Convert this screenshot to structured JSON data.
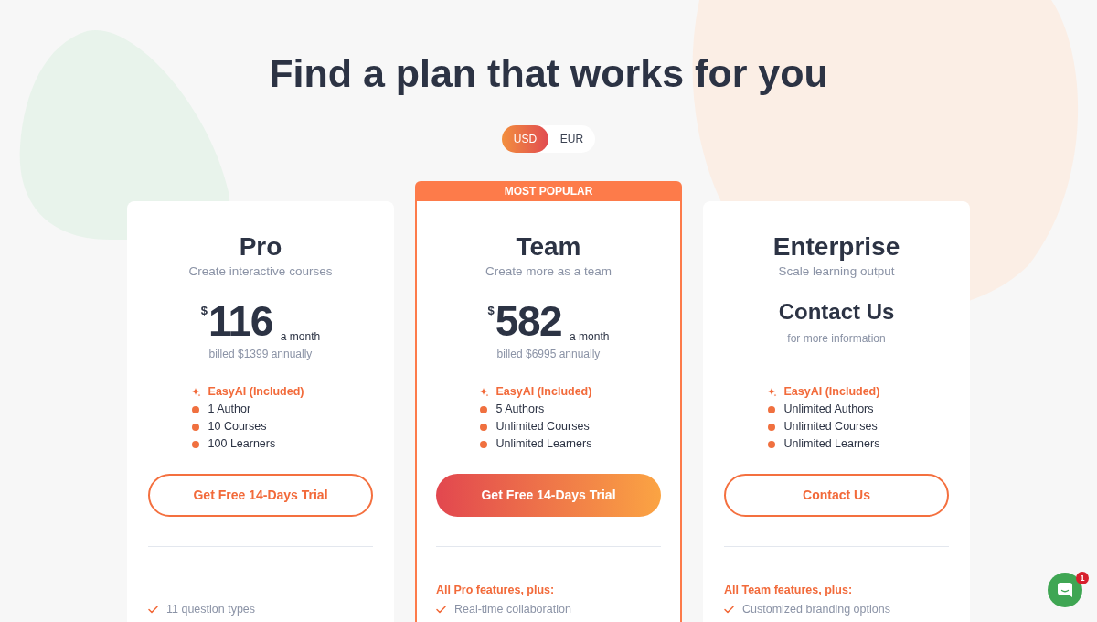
{
  "heading": "Find a plan that works for you",
  "currency_toggle": [
    {
      "label": "USD",
      "selected": true
    },
    {
      "label": "EUR",
      "selected": false
    }
  ],
  "plans": [
    {
      "name": "Pro",
      "featured": false,
      "tagline": "Create interactive courses",
      "price": {
        "kind": "amount",
        "currency": "$",
        "amount": "116",
        "period": "a month",
        "note": "billed $1399 annually"
      },
      "highlights": [
        {
          "kind": "ai",
          "text": "EasyAI (Included)"
        },
        {
          "kind": "bullet",
          "text": "1 Author"
        },
        {
          "kind": "bullet",
          "text": "10 Courses"
        },
        {
          "kind": "bullet",
          "text": "100 Learners"
        }
      ],
      "button": {
        "kind": "outline",
        "label": "Get Free 14-Days Trial"
      },
      "features": [
        "11 question types"
      ]
    },
    {
      "name": "Team",
      "featured": true,
      "badge": "MOST POPULAR",
      "tagline": "Create more as a team",
      "price": {
        "kind": "amount",
        "currency": "$",
        "amount": "582",
        "period": "a month",
        "note": "billed $6995 annually"
      },
      "highlights": [
        {
          "kind": "ai",
          "text": "EasyAI (Included)"
        },
        {
          "kind": "bullet",
          "text": "5 Authors"
        },
        {
          "kind": "bullet",
          "text": "Unlimited Courses"
        },
        {
          "kind": "bullet",
          "text": "Unlimited Learners"
        }
      ],
      "button": {
        "kind": "gradient",
        "label": "Get Free 14-Days Trial"
      },
      "features_intro": "All Pro features, plus:",
      "features": [
        "Real-time collaboration"
      ]
    },
    {
      "name": "Enterprise",
      "featured": false,
      "tagline": "Scale learning output",
      "price": {
        "kind": "contact",
        "title": "Contact Us",
        "note": "for more information"
      },
      "highlights": [
        {
          "kind": "ai",
          "text": "EasyAI (Included)"
        },
        {
          "kind": "bullet",
          "text": "Unlimited Authors"
        },
        {
          "kind": "bullet",
          "text": "Unlimited Courses"
        },
        {
          "kind": "bullet",
          "text": "Unlimited Learners"
        }
      ],
      "button": {
        "kind": "outline",
        "label": "Contact Us"
      },
      "features_intro": "All Team features, plus:",
      "features": [
        "Customized branding options"
      ]
    }
  ],
  "chat_widget": {
    "badge": "1"
  }
}
